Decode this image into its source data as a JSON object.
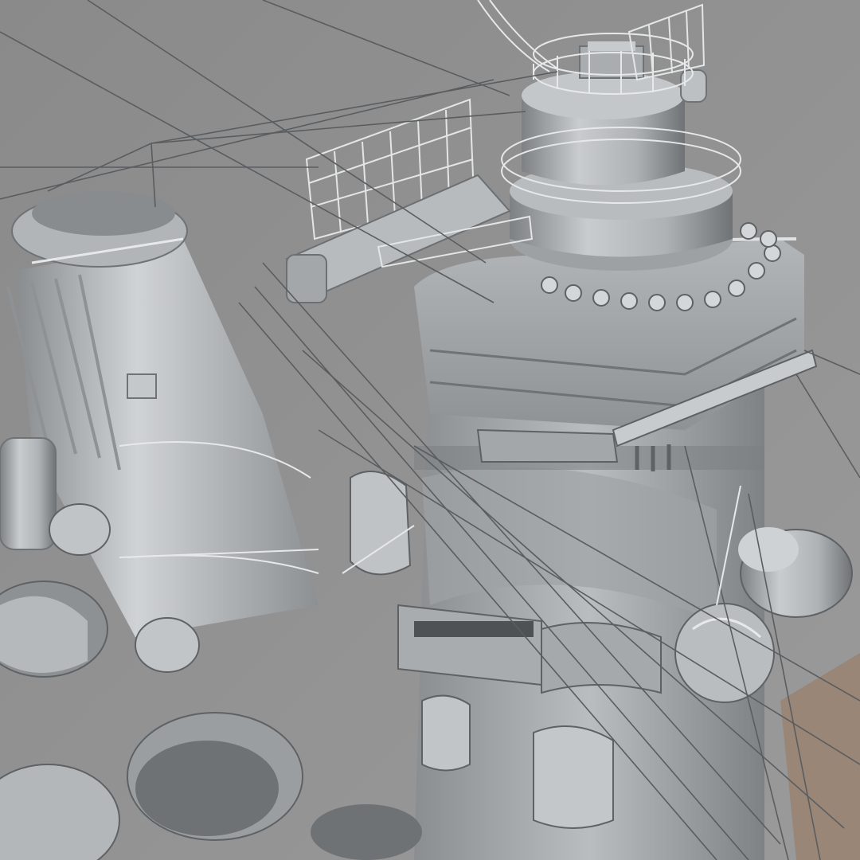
{
  "image": {
    "subject": "warship-superstructure-3d-render",
    "palette": {
      "background": "#8f8f8f",
      "metal_light": "#c9ccce",
      "metal_mid": "#a9adb0",
      "metal_dark": "#73777a",
      "shadow": "#4f5254",
      "deck_tan": "#9a8676",
      "rigging": "#5a5d60",
      "railing": "#e6e8e9"
    }
  }
}
